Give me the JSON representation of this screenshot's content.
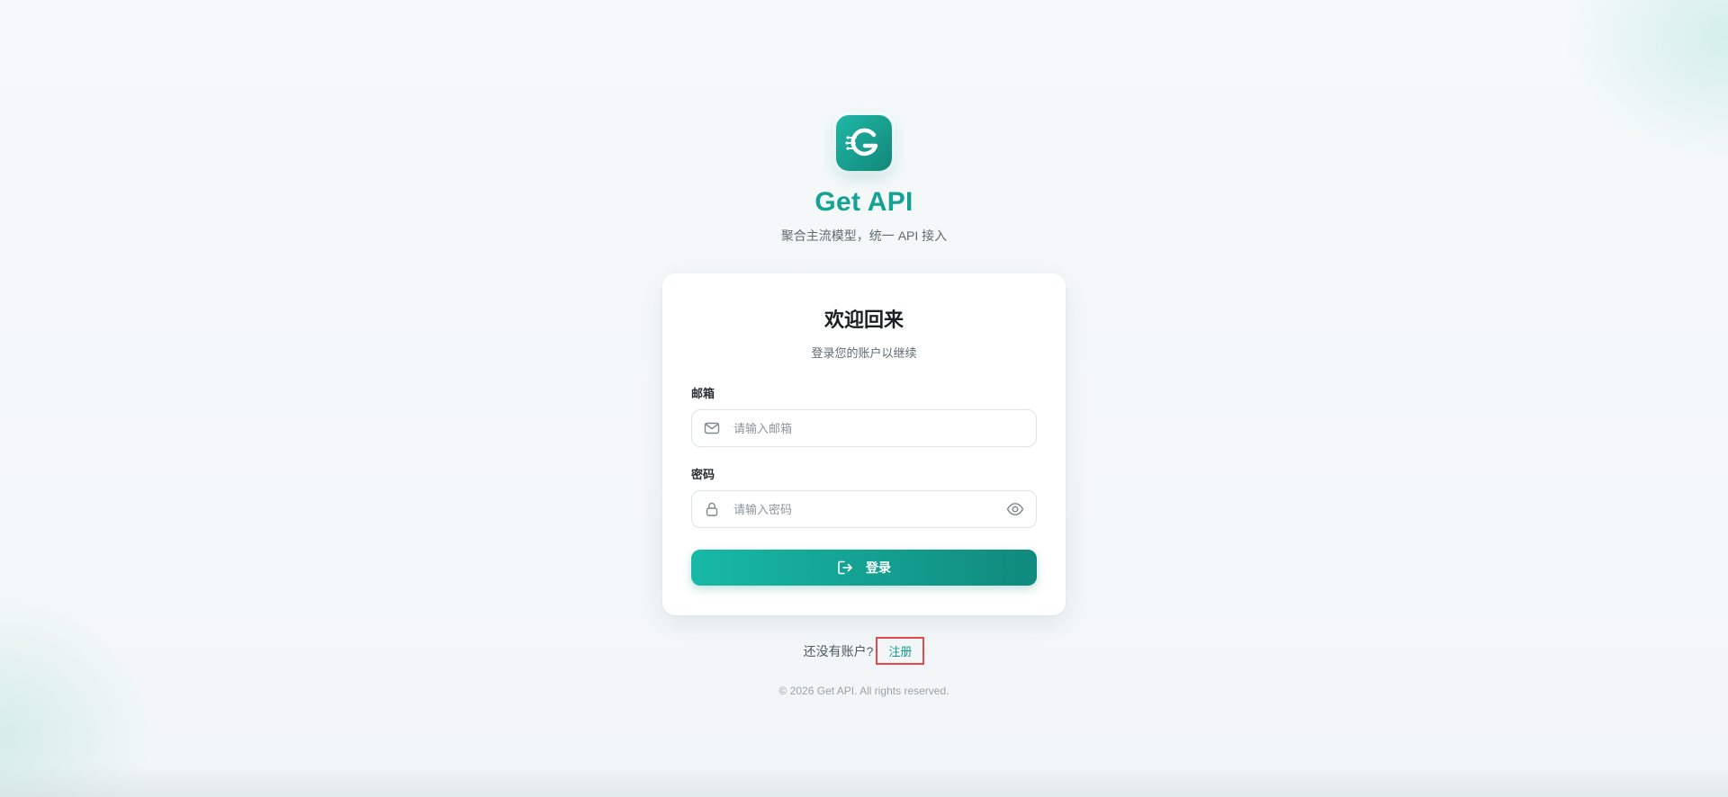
{
  "brand": {
    "name": "Get API",
    "tagline": "聚合主流模型，统一 API 接入",
    "accent_color": "#14a294"
  },
  "card": {
    "title": "欢迎回来",
    "subtitle": "登录您的账户以继续",
    "email": {
      "label": "邮箱",
      "placeholder": "请输入邮箱",
      "icon": "mail-icon"
    },
    "password": {
      "label": "密码",
      "placeholder": "请输入密码",
      "icon": "lock-icon",
      "toggle_icon": "eye-icon"
    },
    "submit": {
      "label": "登录",
      "icon": "login-icon"
    }
  },
  "register": {
    "prompt": "还没有账户?",
    "link_label": "注册"
  },
  "footer": {
    "copyright": "© 2026 Get API. All rights reserved."
  }
}
